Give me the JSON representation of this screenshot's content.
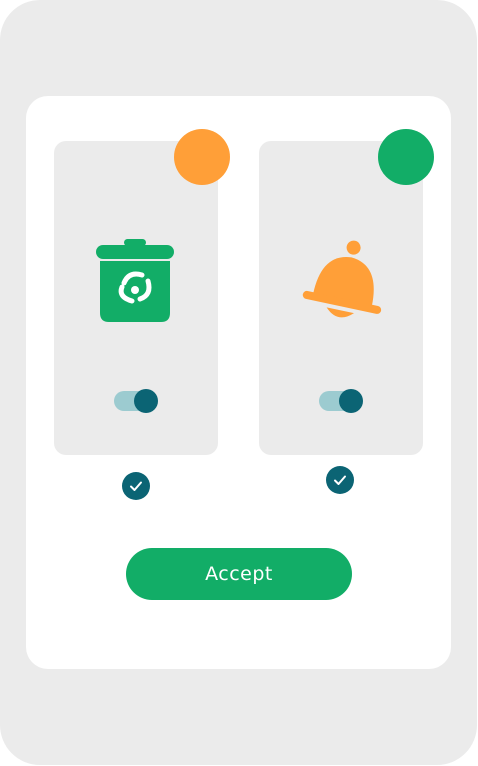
{
  "colors": {
    "orange": "#ff9f38",
    "green": "#12ad67",
    "teal_dark": "#0b6474",
    "teal_light": "#9ccbd0",
    "panel_bg": "#ebebeb",
    "card_bg": "#ffffff"
  },
  "cards": [
    {
      "icon": "recycle-bin-icon",
      "badge_color": "orange",
      "toggle_on": true,
      "selected": true
    },
    {
      "icon": "bell-icon",
      "badge_color": "green",
      "toggle_on": true,
      "selected": true
    }
  ],
  "actions": {
    "accept_label": "Accept"
  }
}
